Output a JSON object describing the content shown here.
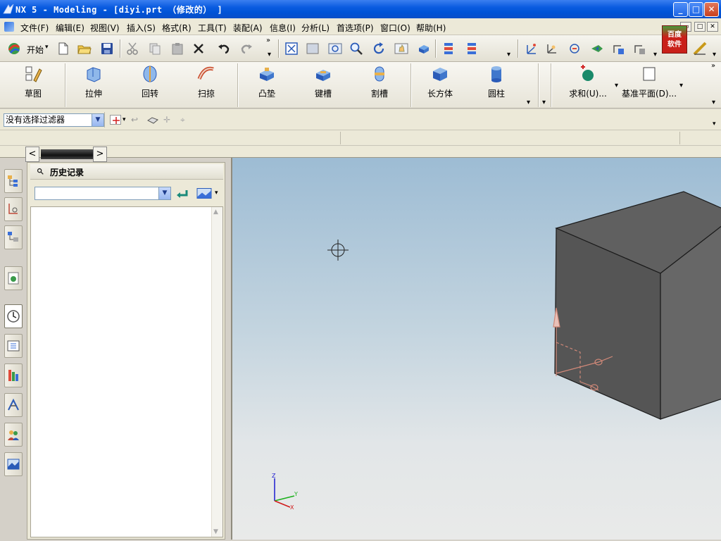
{
  "window": {
    "title": "NX 5 - Modeling - [diyi.prt （修改的） ]",
    "controls": {
      "minimize": "_",
      "maximize": "□",
      "close": "✕"
    }
  },
  "menubar": {
    "items": [
      "文件(F)",
      "编辑(E)",
      "视图(V)",
      "插入(S)",
      "格式(R)",
      "工具(T)",
      "装配(A)",
      "信息(I)",
      "分析(L)",
      "首选项(P)",
      "窗口(O)",
      "帮助(H)"
    ]
  },
  "badge": {
    "line1": "百度",
    "line2": "软件"
  },
  "toolbar_standard": {
    "start_label": "开始",
    "start_arrow": "▾",
    "overflow": "»"
  },
  "feature_toolbar": {
    "items": [
      {
        "label": "草图",
        "icon": "sketch-icon"
      },
      {
        "label": "拉伸",
        "icon": "extrude-icon"
      },
      {
        "label": "回转",
        "icon": "revolve-icon"
      },
      {
        "label": "扫掠",
        "icon": "sweep-icon"
      },
      {
        "label": "凸垫",
        "icon": "pad-icon"
      },
      {
        "label": "键槽",
        "icon": "slot-icon"
      },
      {
        "label": "割槽",
        "icon": "groove-icon"
      },
      {
        "label": "长方体",
        "icon": "block-icon"
      },
      {
        "label": "圆柱",
        "icon": "cylinder-icon"
      }
    ],
    "unite_label": "求和(U)...",
    "datum_label": "基准平面(D)...",
    "overflow": "»"
  },
  "selection_bar": {
    "filter_value": "没有选择过滤器"
  },
  "navigator": {
    "tab_left": "<",
    "tab_right": ">",
    "title": "历史记录",
    "combo_value": ""
  },
  "resource_bar": {
    "icons": [
      "assembly-navigator-icon",
      "constraint-navigator-icon",
      "part-navigator-icon",
      "internet-explorer-icon",
      "history-icon",
      "reuse-library-icon",
      "palette-icon",
      "process-studio-icon",
      "roles-icon",
      "system-visualization-icon"
    ]
  },
  "graphics": {
    "wcs_labels": {
      "z": "Z",
      "y": "Y",
      "x": "X"
    },
    "colors": {
      "cube_top": "#606060",
      "cube_front": "#555555",
      "cube_side": "#666666",
      "background_top": "#9dbcd4"
    }
  }
}
